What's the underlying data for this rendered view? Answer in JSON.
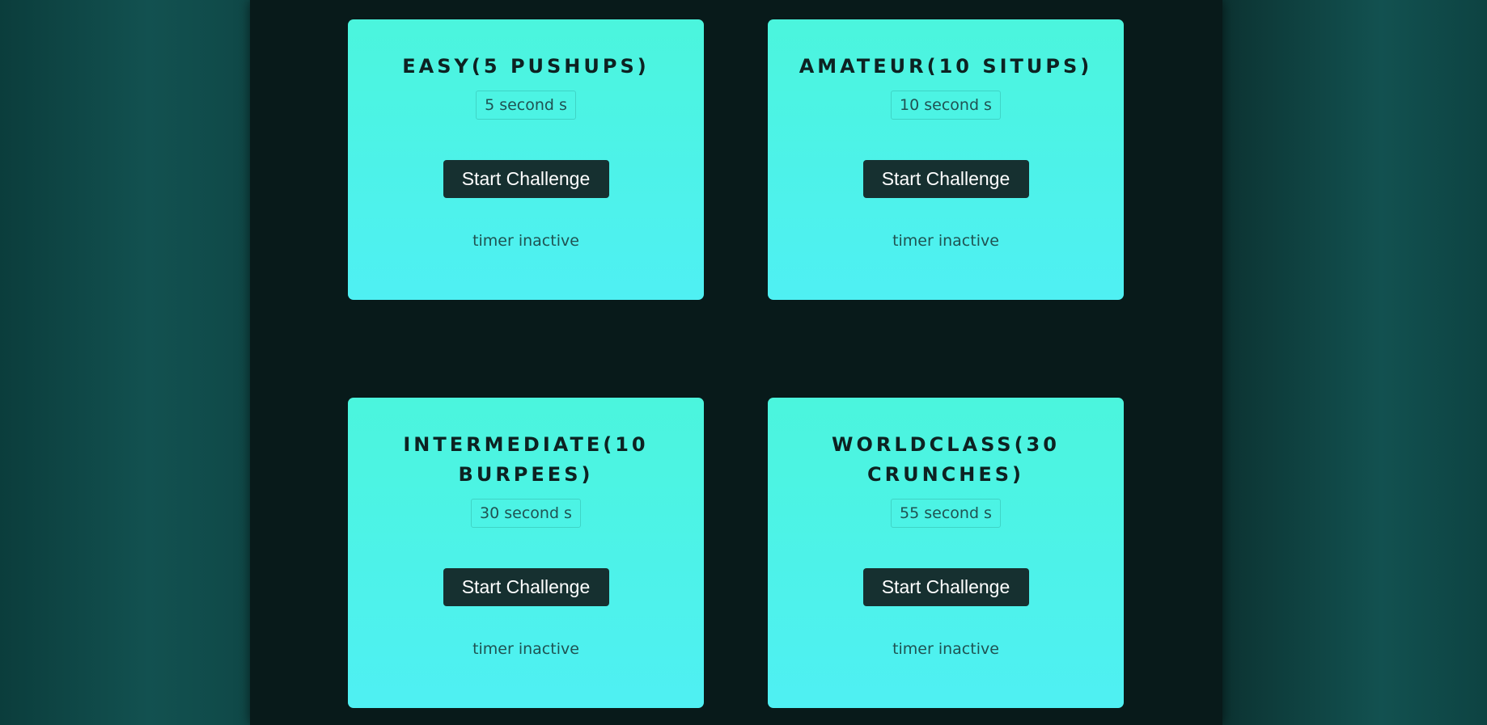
{
  "challenges": [
    {
      "title": "EASY(5 PUSHUPS)",
      "duration": "5 second s",
      "button": "Start Challenge",
      "status": "timer inactive"
    },
    {
      "title": "AMATEUR(10 SITUPS)",
      "duration": "10 second s",
      "button": "Start Challenge",
      "status": "timer inactive"
    },
    {
      "title": "INTERMEDIATE(10 BURPEES)",
      "duration": "30 second s",
      "button": "Start Challenge",
      "status": "timer inactive"
    },
    {
      "title": "WORLDCLASS(30 CRUNCHES)",
      "duration": "55 second s",
      "button": "Start Challenge",
      "status": "timer inactive"
    }
  ],
  "colors": {
    "card_top": "#4bf5dd",
    "card_bottom": "#4ff0f3",
    "button": "#163030",
    "panel": "#081a1a"
  }
}
